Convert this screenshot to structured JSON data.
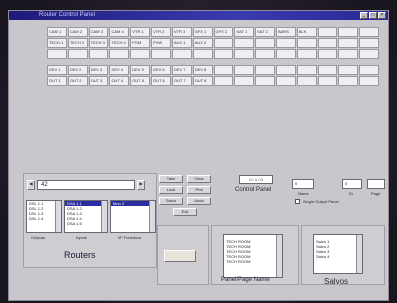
{
  "window": {
    "title": "Router Control Panel"
  },
  "grid": {
    "rows": [
      [
        "CAM 1",
        "CAM 2",
        "CAM 3",
        "CAM 4",
        "VTR 1",
        "VTR 2",
        "VTR 3",
        "GFX 1",
        "GFX 2",
        "SAT 1",
        "SAT 2",
        "BARS",
        "BLK",
        "",
        "",
        ""
      ],
      [
        "TECH 1",
        "TECH 2",
        "TECH 3",
        "TECH 4",
        "PGM",
        "PVW",
        "AUX 1",
        "AUX 2",
        "",
        "",
        "",
        "",
        "",
        "",
        "",
        ""
      ],
      [
        "",
        "",
        "",
        "",
        "",
        "",
        "",
        "",
        "",
        "",
        "",
        "",
        "",
        "",
        "",
        ""
      ],
      [
        "DEV 1",
        "DEV 2",
        "DEV 3",
        "DEV 4",
        "DEV 5",
        "DEV 6",
        "DEV 7",
        "DEV 8",
        "",
        "",
        "",
        "",
        "",
        "",
        "",
        ""
      ],
      [
        "OUT 1",
        "OUT 2",
        "OUT 3",
        "OUT 4",
        "OUT 5",
        "OUT 6",
        "OUT 7",
        "OUT 8",
        "",
        "",
        "",
        "",
        "",
        "",
        "",
        ""
      ]
    ]
  },
  "routers": {
    "selector_value": "42",
    "outputs": [
      "DSL 1.1",
      "DSL 1.2",
      "DSL 1.3",
      "DSL 1.4"
    ],
    "inputs": [
      "DSA 1.1",
      "DSA 1.2",
      "DSA 1.3",
      "DSA 1.4",
      "DSA 1.5"
    ],
    "inputs_selected": 0,
    "functions": [
      "Mon 2",
      "",
      "",
      ""
    ],
    "functions_selected": 0,
    "outputs_label": "Outputs",
    "inputs_label": "Inputs",
    "functions_label": "I/F Functions",
    "section_label": "Routers"
  },
  "control_panel": {
    "buttons": [
      "Take",
      "Clear",
      "Lock",
      "Prot",
      "Salvo",
      "Undo",
      "Exit"
    ],
    "label": "Control Panel",
    "readout": "0 / 1 / 0"
  },
  "right_fields": {
    "values": [
      "0",
      "0",
      ""
    ],
    "labels": [
      "Name",
      "ID",
      "Page"
    ],
    "checkbox_label": "Single Output Panel"
  },
  "panel_page": {
    "items": [
      "TECH ROOM",
      "TECH ROOM",
      "TECH ROOM",
      "TECH ROOM",
      "TECH ROOM"
    ],
    "label": "Panel/Page Name"
  },
  "salvos": {
    "items": [
      "Salvo 1",
      "Salvo 2",
      "Salvo 3",
      "Salvo 4"
    ],
    "label": "Salvos"
  }
}
